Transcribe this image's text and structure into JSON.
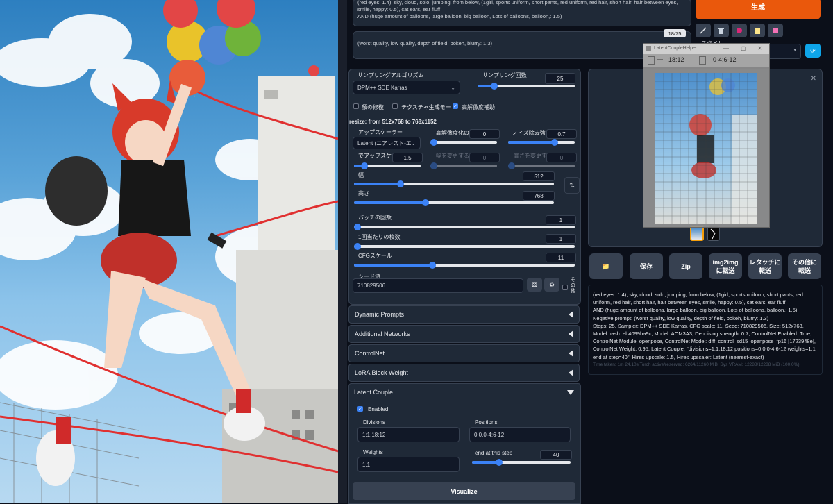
{
  "prompt": {
    "positive_text": "(red eyes: 1.4), sky, cloud, solo, jumping, from below, (1girl, sports uniform, short pants, red uniform, red hair, short hair, hair between eyes, smile, happy: 0.5), cat ears, ear fluff\nAND (huge amount of balloons, large balloon, big balloon, Lots of balloons, balloon,: 1.5)",
    "negative_text": "(worst quality, low quality, depth of field, bokeh, blurry: 1.3)",
    "token_count": "18/75"
  },
  "generate_label": "生成",
  "style_label": "スタイル",
  "toolbar_icons": [
    "pencil-icon",
    "trash-icon",
    "pink-dot-icon",
    "clipboard-icon",
    "save-icon"
  ],
  "sampling": {
    "method_label": "サンプリングアルゴリズム",
    "method_value": "DPM++ SDE Karras",
    "steps_label": "サンプリング回数",
    "steps_value": "25",
    "steps_fraction": 0.17
  },
  "checkboxes": [
    {
      "label": "顔の修復",
      "checked": false
    },
    {
      "label": "テクスチャ生成モード",
      "checked": false
    },
    {
      "label": "高解像度補助",
      "checked": true
    }
  ],
  "hires": {
    "resize_text": "resize: from 512x768 to 768x1152",
    "upscaler_label": "アップスケーラー",
    "upscaler_value": "Latent (ニアレスト-エグ",
    "hires_steps_label": "高解像度化の(",
    "hires_steps_value": "0",
    "denoise_label": "ノイズ除去強度",
    "denoise_value": "0.7",
    "upscale_by_label": "でアップスケール",
    "upscale_by_value": "1.5",
    "resize_w_label": "幅を変更する",
    "resize_w_value": "0",
    "resize_h_label": "高さを変更する",
    "resize_h_value": "0"
  },
  "dims": {
    "width_label": "幅",
    "width_value": "512",
    "height_label": "高さ",
    "height_value": "768",
    "swap_icon": "swap-icon"
  },
  "batch": {
    "count_label": "バッチの回数",
    "count_value": "1",
    "size_label": "1回当たりの枚数",
    "size_value": "1"
  },
  "cfg": {
    "label": "CFGスケール",
    "value": "11"
  },
  "seed": {
    "label": "シード値",
    "value": "710829506",
    "extra_label": "その他"
  },
  "accordions": [
    {
      "label": "Dynamic Prompts"
    },
    {
      "label": "Additional Networks"
    },
    {
      "label": "ControlNet"
    },
    {
      "label": "LoRA Block Weight"
    }
  ],
  "latent_couple": {
    "title": "Latent Couple",
    "enabled_label": "Enabled",
    "divisions_label": "Divisions",
    "divisions_value": "1:1,18:12",
    "positions_label": "Positions",
    "positions_value": "0:0,0-4:6-12",
    "weights_label": "Weights",
    "weights_value": "1,1",
    "end_step_label": "end at this step",
    "end_step_value": "40",
    "visualize_label": "Visualize"
  },
  "helper_window": {
    "title": "LatentCoupleHelper",
    "divisions": "18:12",
    "positions": "0-4:6-12"
  },
  "output_buttons": [
    {
      "label": "📁",
      "name": "open-folder-button"
    },
    {
      "label": "保存",
      "name": "save-button"
    },
    {
      "label": "Zip",
      "name": "zip-button"
    },
    {
      "label": "img2img\nに転送",
      "name": "send-img2img-button"
    },
    {
      "label": "レタッチに\n転送",
      "name": "send-inpaint-button"
    },
    {
      "label": "その他に\n転送",
      "name": "send-extras-button"
    }
  ],
  "info": {
    "text": "(red eyes: 1.4), sky, cloud, solo, jumping, from below, (1girl, sports uniform, short pants, red uniform, red hair, short hair, hair between eyes, smile, happy: 0.5), cat ears, ear fluff\nAND (huge amount of balloons, large balloon, big balloon, Lots of balloons, balloon,: 1.5)\nNegative prompt: (worst quality, low quality, depth of field, bokeh, blurry: 1.3)\nSteps: 25, Sampler: DPM++ SDE Karras, CFG scale: 11, Seed: 710829506, Size: 512x768, Model hash: eb4099ba9c, Model: AOM3A3, Denoising strength: 0.7, ControlNet Enabled: True, ControlNet Module: openpose, ControlNet Model: diff_control_sd15_openpose_fp16 [1723948e], ControlNet Weight: 0.95, Latent Couple: \"divisions=1:1,18:12 positions=0:0,0-4:6-12 weights=1,1 end at step=40\", Hires upscale: 1.5, Hires upscaler: Latent (nearest-exact)",
    "time_text": "Time taken: 1m 24.10s  Torch active/reserved: 6264/11260 MiB, Sys VRAM: 12288/12288 MiB (100.0%)"
  },
  "colors": {
    "accent_blue": "#3b82f6",
    "generate_orange": "#ea580c",
    "background": "#0b0f19",
    "panel": "#1f2937"
  }
}
